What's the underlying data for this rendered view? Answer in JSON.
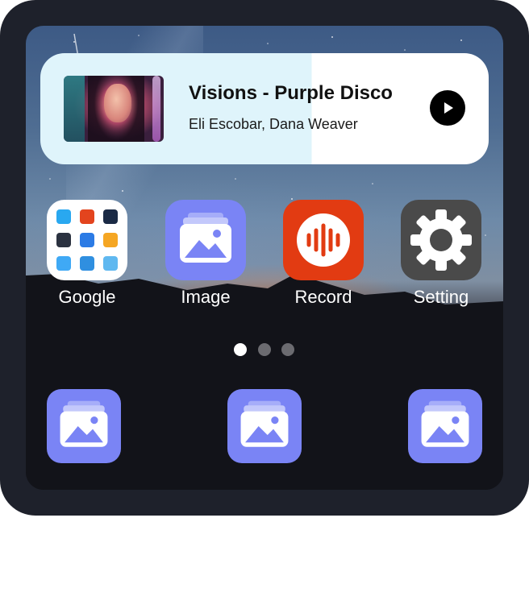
{
  "music_widget": {
    "title": "Visions - Purple Disco",
    "artist": "Eli Escobar, Dana Weaver",
    "play_icon": "play-icon"
  },
  "apps": [
    {
      "label": "Google",
      "icon": "google-folder-icon"
    },
    {
      "label": "Image",
      "icon": "image-icon"
    },
    {
      "label": "Record",
      "icon": "record-icon"
    },
    {
      "label": "Setting",
      "icon": "gear-icon"
    }
  ],
  "pager": {
    "pages": 3,
    "active": 1
  },
  "dock": [
    {
      "icon": "image-icon"
    },
    {
      "icon": "image-icon"
    },
    {
      "icon": "image-icon"
    }
  ],
  "colors": {
    "device_frame": "#1e212b",
    "image_app": "#7a84f5",
    "record_app": "#e23b12",
    "setting_app": "#4a4a4a",
    "widget_left": "#dff4fb",
    "widget_right": "#ffffff"
  }
}
